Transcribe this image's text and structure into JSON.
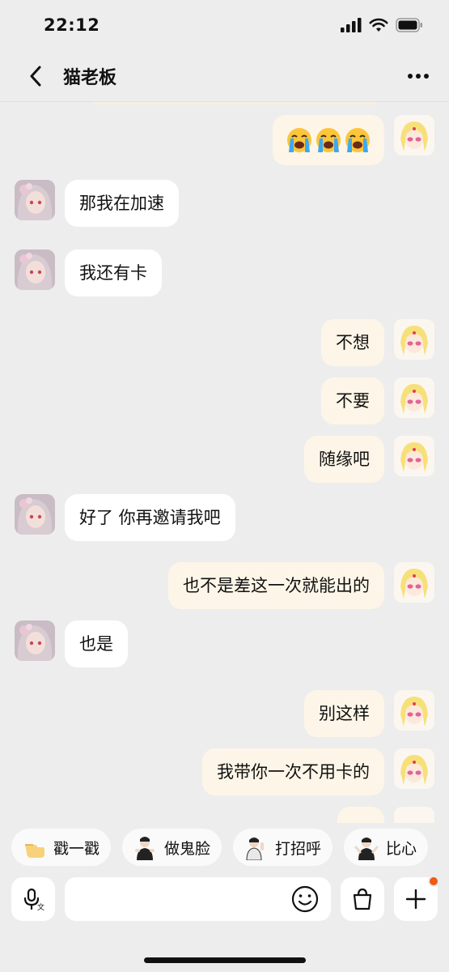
{
  "status_bar": {
    "time": "22:12",
    "icons": [
      "signal-icon",
      "wifi-icon",
      "battery-icon"
    ]
  },
  "nav": {
    "title": "猫老板",
    "back_icon": "chevron-left-icon",
    "more_icon": "ellipsis-icon"
  },
  "messages": [
    {
      "side": "right",
      "type": "emoji",
      "emoji_name": "loudly-crying-face",
      "count": 3,
      "text": ""
    },
    {
      "side": "left",
      "text": "那我在加速"
    },
    {
      "side": "left",
      "text": "我还有卡"
    },
    {
      "side": "right",
      "text": "不想"
    },
    {
      "side": "right",
      "text": "不要"
    },
    {
      "side": "right",
      "text": "随缘吧"
    },
    {
      "side": "left",
      "text": "好了 你再邀请我吧"
    },
    {
      "side": "right",
      "text": "也不是差这一次就能出的"
    },
    {
      "side": "left",
      "text": "也是"
    },
    {
      "side": "right",
      "text": "别这样"
    },
    {
      "side": "right",
      "text": "我带你一次不用卡的"
    }
  ],
  "quick_actions": [
    {
      "label": "戳一戳",
      "icon": "poke-hand-icon"
    },
    {
      "label": "做鬼脸",
      "icon": "funny-face-sticker-icon"
    },
    {
      "label": "打招呼",
      "icon": "wave-hello-sticker-icon"
    },
    {
      "label": "比心",
      "icon": "finger-heart-sticker-icon"
    }
  ],
  "input_bar": {
    "voice_icon": "microphone-translate-icon",
    "placeholder": "",
    "emoji_icon": "smiley-face-icon",
    "shop_icon": "shopping-bag-icon",
    "plus_icon": "plus-icon",
    "notification_dot_color": "#f05a14"
  },
  "colors": {
    "background": "#ededed",
    "self_bubble": "#fdf6e8",
    "other_bubble": "#ffffff"
  }
}
